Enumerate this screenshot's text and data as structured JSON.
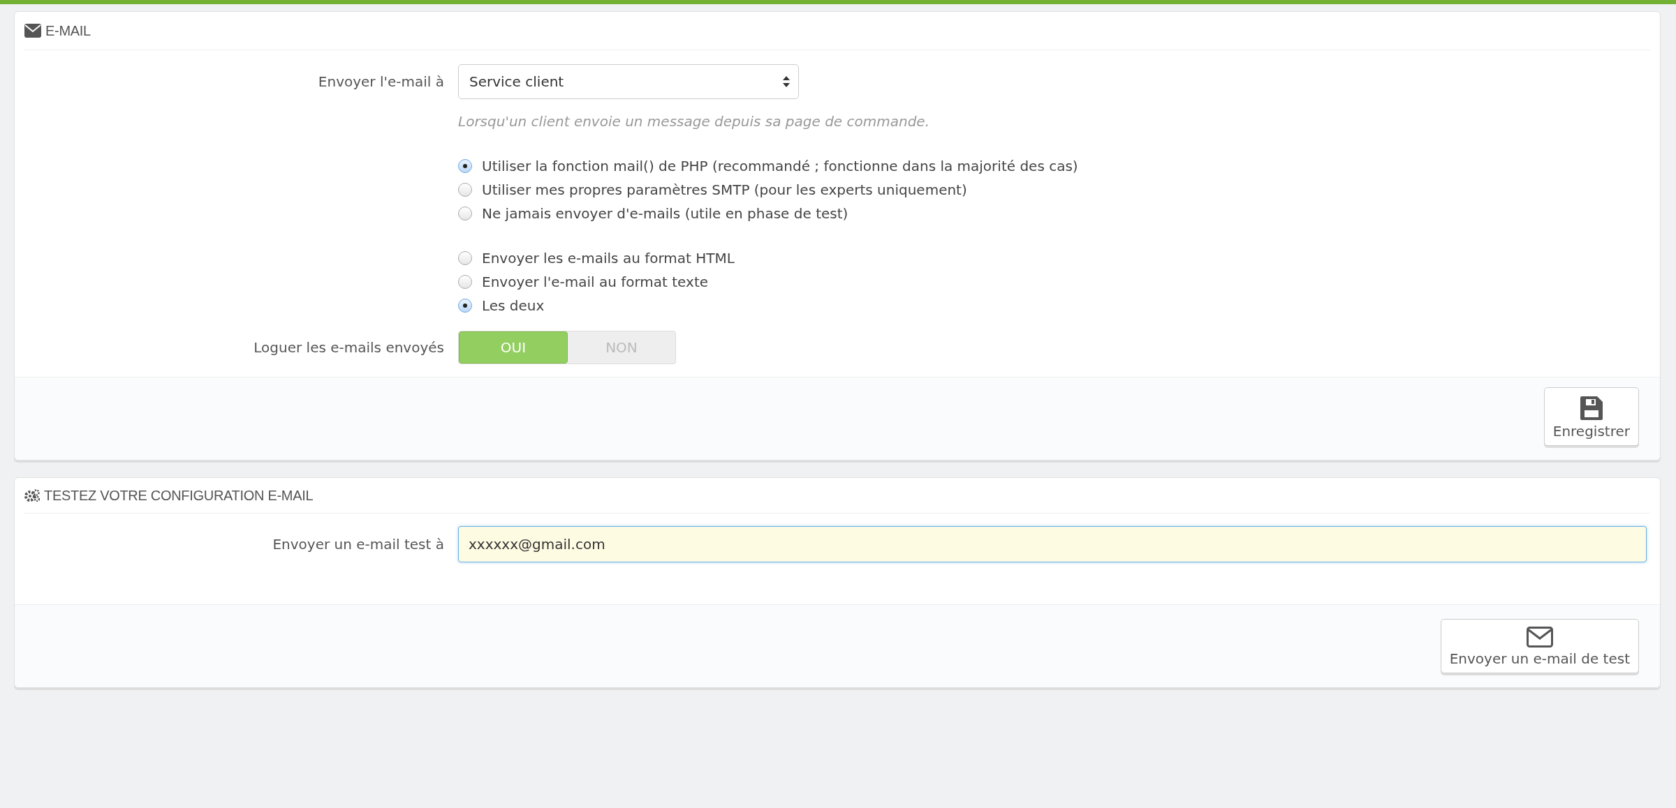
{
  "email_panel": {
    "title": "E-MAIL",
    "send_to": {
      "label": "Envoyer l'e-mail à",
      "value": "Service client",
      "hint": "Lorsqu'un client envoie un message depuis sa page de commande."
    },
    "radio_groups": [
      {
        "options": [
          {
            "label": "Utiliser la fonction mail() de PHP (recommandé ; fonctionne dans la majorité des cas)",
            "selected": true
          },
          {
            "label": "Utiliser mes propres paramètres SMTP (pour les experts uniquement)",
            "selected": false
          },
          {
            "label": "Ne jamais envoyer d'e-mails (utile en phase de test)",
            "selected": false
          }
        ]
      },
      {
        "options": [
          {
            "label": "Envoyer les e-mails au format HTML",
            "selected": false
          },
          {
            "label": "Envoyer l'e-mail au format texte",
            "selected": false
          },
          {
            "label": "Les deux",
            "selected": true
          }
        ]
      }
    ],
    "log_toggle": {
      "label": "Loguer les e-mails envoyés",
      "options": [
        {
          "label": "OUI",
          "selected": true
        },
        {
          "label": "NON",
          "selected": false
        }
      ]
    },
    "save_button": "Enregistrer"
  },
  "test_panel": {
    "title": "TESTEZ VOTRE CONFIGURATION E-MAIL",
    "field": {
      "label": "Envoyer un e-mail test à",
      "value": "xxxxxx@gmail.com"
    },
    "send_button": "Envoyer un e-mail de test"
  }
}
